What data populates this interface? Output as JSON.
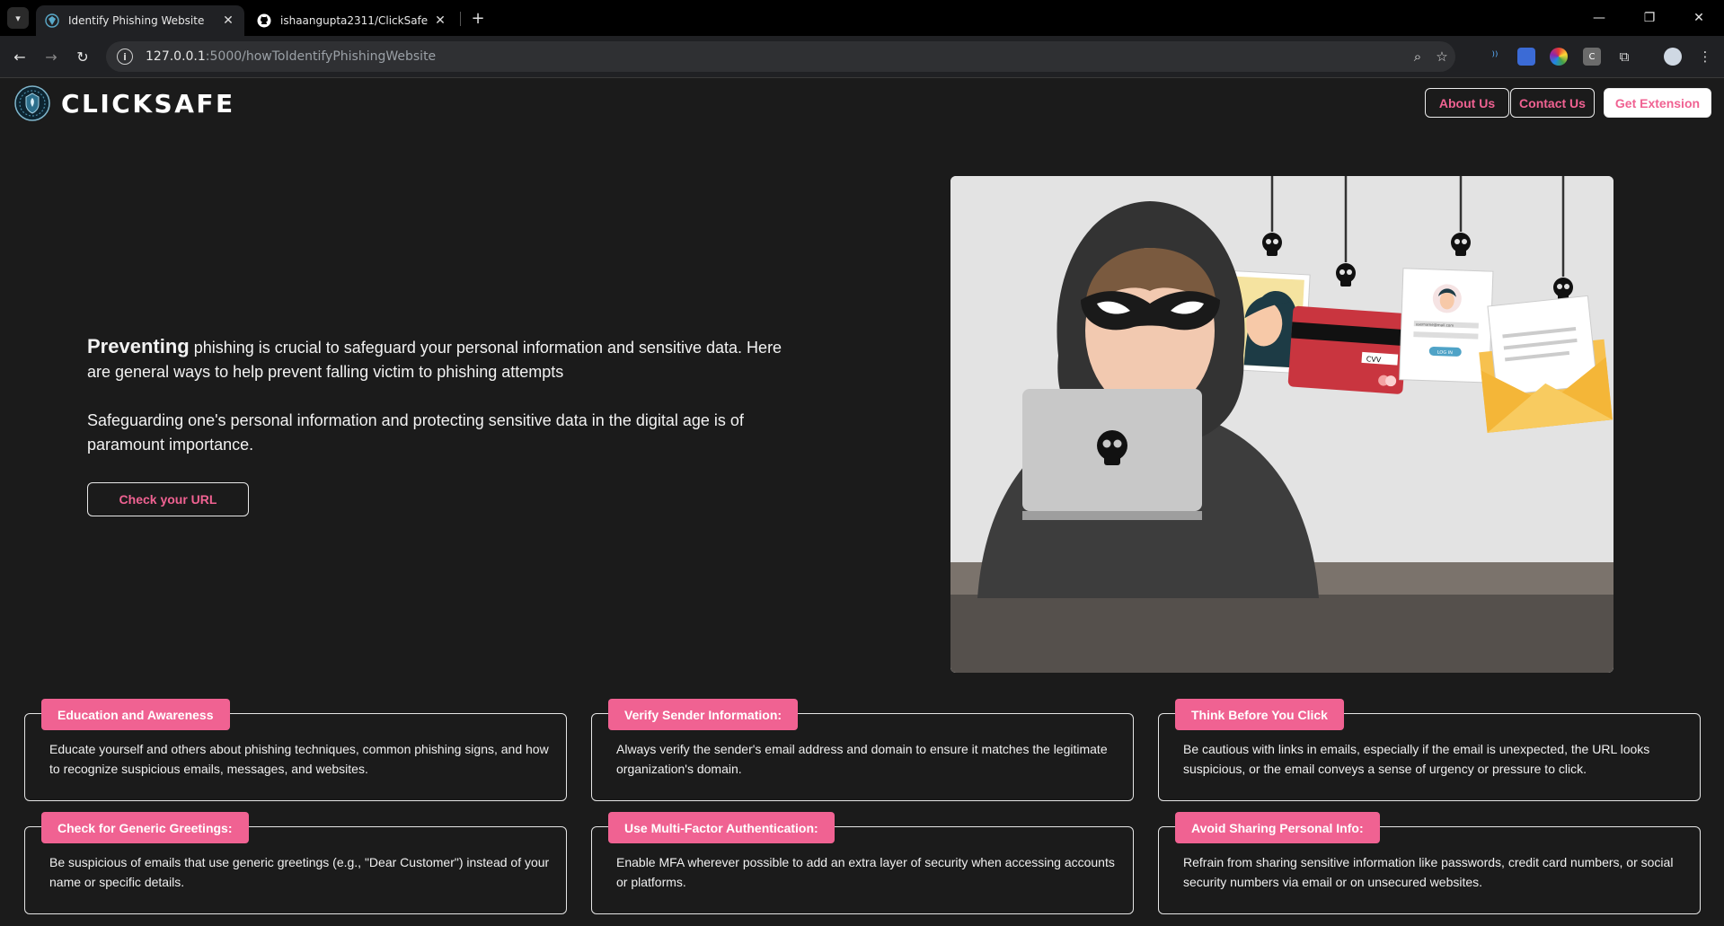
{
  "browser": {
    "tabs": [
      {
        "title": "Identify Phishing Website",
        "active": true
      },
      {
        "title": "ishaangupta2311/ClickSafe",
        "active": false
      }
    ],
    "url_host": "127.0.0.1",
    "url_rest": ":5000/howToIdentifyPhishingWebsite"
  },
  "header": {
    "brand": "CLICKSAFE",
    "nav": {
      "about": "About Us",
      "contact": "Contact Us",
      "extension": "Get Extension"
    }
  },
  "hero": {
    "lead_bold": "Preventing",
    "lead_rest": " phishing is crucial to safeguard your personal information and sensitive data. Here are general ways to help prevent falling victim to phishing attempts",
    "para2": "Safeguarding one's personal information and protecting sensitive data in the digital age is of paramount importance.",
    "cta": "Check your URL"
  },
  "illustration": {
    "cvv": "CVV",
    "login": "LOG IN",
    "email_sample": "username@mail.com"
  },
  "tips": [
    {
      "title": "Education and Awareness",
      "text": "Educate yourself and others about phishing techniques, common phishing signs, and how to recognize suspicious emails, messages, and websites."
    },
    {
      "title": "Verify Sender Information:",
      "text": "Always verify the sender's email address and domain to ensure it matches the legitimate organization's domain."
    },
    {
      "title": "Think Before You Click",
      "text": "Be cautious with links in emails, especially if the email is unexpected, the URL looks suspicious, or the email conveys a sense of urgency or pressure to click."
    },
    {
      "title": "Check for Generic Greetings:",
      "text": "Be suspicious of emails that use generic greetings (e.g., \"Dear Customer\") instead of your name or specific details."
    },
    {
      "title": "Use Multi-Factor Authentication:",
      "text": "Enable MFA wherever possible to add an extra layer of security when accessing accounts or platforms."
    },
    {
      "title": "Avoid Sharing Personal Info:",
      "text": "Refrain from sharing sensitive information like passwords, credit card numbers, or social security numbers via email or on unsecured websites."
    }
  ],
  "colors": {
    "accent": "#f06292",
    "page_bg": "#1b1b1b",
    "text": "#f2f2f2"
  }
}
